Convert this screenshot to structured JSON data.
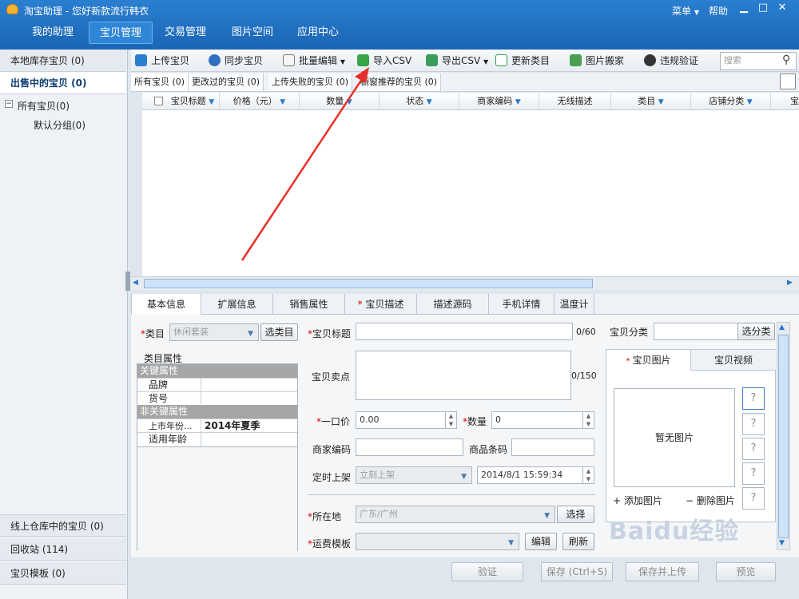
{
  "app": {
    "title": "淘宝助理 - 您好新款流行韩衣",
    "menu_label": "菜单",
    "help_label": "帮助"
  },
  "nav": {
    "items": [
      "我的助理",
      "宝贝管理",
      "交易管理",
      "图片空间",
      "应用中心"
    ],
    "active": "宝贝管理"
  },
  "sidebar": {
    "local_store": "本地库存宝贝 (0)",
    "on_sale": "出售中的宝贝 (0)",
    "tree_root": "所有宝贝(0)",
    "tree_child": "默认分组(0)",
    "online_warehouse": "线上仓库中的宝贝 (0)",
    "recycle": "回收站 (114)",
    "templates": "宝贝模板 (0)"
  },
  "toolbar": {
    "items": [
      "上传宝贝",
      "同步宝贝",
      "批量编辑",
      "导入CSV",
      "导出CSV",
      "更新类目",
      "图片搬家",
      "违规验证"
    ],
    "search_placeholder": "搜索"
  },
  "subtabs": [
    "所有宝贝 (0)",
    "更改过的宝贝 (0)",
    "上传失败的宝贝 (0)",
    "橱窗推荐的宝贝 (0)"
  ],
  "columns": [
    "宝贝标题",
    "价格（元）",
    "数量",
    "状态",
    "商家编码",
    "无线描述",
    "类目",
    "店铺分类",
    "宝"
  ],
  "detail_tabs": [
    "基本信息",
    "扩展信息",
    "销售属性",
    "宝贝描述",
    "描述源码",
    "手机详情",
    "温度计"
  ],
  "form": {
    "category_label": "类目",
    "category_value": "休闲套装",
    "select_category": "选类目",
    "title_label": "宝贝标题",
    "title_count": "0/60",
    "shop_category_label": "宝贝分类",
    "select_shop_category": "选分类",
    "selling_point_label": "宝贝卖点",
    "selling_point_count": "0/150",
    "price_label": "一口价",
    "price_value": "0.00",
    "qty_label": "数量",
    "qty_value": "0",
    "merchant_code_label": "商家编码",
    "barcode_label": "商品条码",
    "schedule_label": "定时上架",
    "schedule_value": "立刻上架",
    "schedule_time": "2014/8/1 15:59:34",
    "location_label": "所在地",
    "location_value": "广东/广州",
    "select_btn": "选择",
    "shipping_label": "运费模板",
    "edit_btn": "编辑",
    "refresh_btn": "刷新"
  },
  "props": {
    "title": "类目属性",
    "key_group": "关键属性",
    "brand": "品牌",
    "item_no": "货号",
    "nonkey_group": "非关键属性",
    "market_year": "上市年份...",
    "market_year_value": "2014年夏季",
    "age": "适用年龄"
  },
  "images": {
    "tab_images": "宝贝图片",
    "tab_video": "宝贝视频",
    "no_image": "暂无图片",
    "add": "+ 添加图片",
    "remove": "− 删除图片"
  },
  "bottom": {
    "verify": "验证",
    "save": "保存 (Ctrl+S)",
    "save_upload": "保存并上传",
    "preview": "预览"
  },
  "watermark": "Baidu经验",
  "colors": {
    "title_blue": "#1b65b5",
    "accent": "#2a79c9",
    "arrow": "#e8302a"
  }
}
